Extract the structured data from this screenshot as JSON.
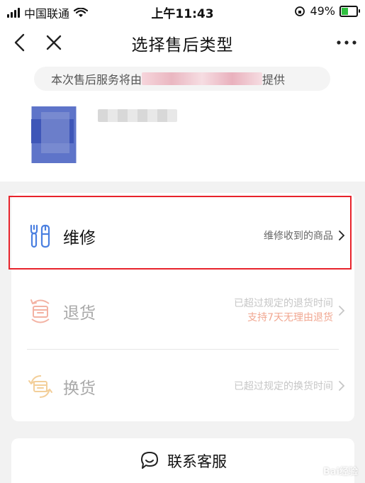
{
  "status_bar": {
    "carrier": "中国联通",
    "time": "上午11:43",
    "battery": "49%"
  },
  "header": {
    "title": "选择售后类型"
  },
  "notice": {
    "prefix": "本次售后服务将由",
    "suffix": "提供"
  },
  "options": {
    "repair": {
      "label": "维修",
      "desc": "维修收到的商品"
    },
    "return": {
      "label": "退货",
      "desc_line1": "已超过规定的退货时间",
      "desc_line2": "支持7天无理由退货"
    },
    "exchange": {
      "label": "换货",
      "desc": "已超过规定的换货时间"
    }
  },
  "customer_service": {
    "label": "联系客服"
  },
  "watermark": "Bai经验",
  "colors": {
    "highlight": "#e8232b",
    "repair_icon": "#4a7fe0",
    "return_icon": "#f3b2a3",
    "exchange_icon": "#f3cf9a",
    "accent_text": "#f1a791"
  }
}
